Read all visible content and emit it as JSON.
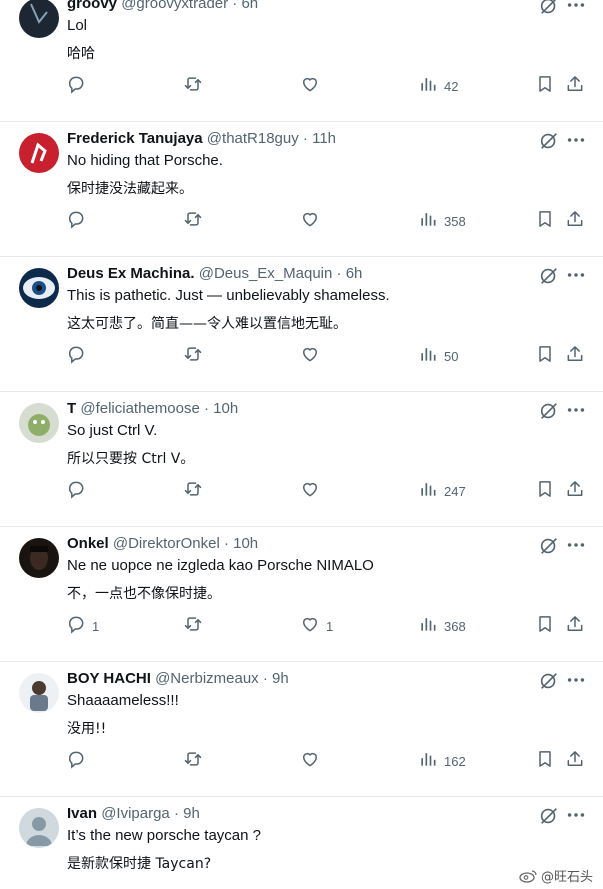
{
  "tweets": [
    {
      "name": "groovy",
      "handle": "@groovyxtrader",
      "time": "6h",
      "text_en": "Lol",
      "text_zh": "哈哈",
      "replies": "",
      "likes": "",
      "views": "42",
      "avatar_color": "#1c2733"
    },
    {
      "name": "Frederick Tanujaya",
      "handle": "@thatR18guy",
      "time": "11h",
      "text_en": "No hiding that Porsche.",
      "text_zh": "保时捷没法藏起来。",
      "replies": "",
      "likes": "",
      "views": "358",
      "avatar_color": "#c8202f"
    },
    {
      "name": "Deus Ex Machina.",
      "handle": "@Deus_Ex_Maquin",
      "time": "6h",
      "text_en": "This is pathetic. Just — unbelievably shameless.",
      "text_zh": "这太可悲了。简直——令人难以置信地无耻。",
      "replies": "",
      "likes": "",
      "views": "50",
      "avatar_color": "#1b4f8a"
    },
    {
      "name": "T",
      "handle": "@feliciathemoose",
      "time": "10h",
      "text_en": "So just Ctrl V.",
      "text_zh": "所以只要按 Ctrl V。",
      "replies": "",
      "likes": "",
      "views": "247",
      "avatar_color": "#8fae6a"
    },
    {
      "name": "Onkel",
      "handle": "@DirektorOnkel",
      "time": "10h",
      "text_en": "Ne ne uopce ne izgleda kao Porsche NIMALO",
      "text_zh": "不，一点也不像保时捷。",
      "replies": "1",
      "likes": "1",
      "views": "368",
      "avatar_color": "#3a2a22"
    },
    {
      "name": "BOY HACHI",
      "handle": "@Nerbizmeaux",
      "time": "9h",
      "text_en": "Shaaaameless!!!",
      "text_zh": "没用!!",
      "replies": "",
      "likes": "",
      "views": "162",
      "avatar_color": "#6a7a8c"
    },
    {
      "name": "Ivan",
      "handle": "@Iviparga",
      "time": "9h",
      "text_en": "It’s the new porsche taycan ?",
      "text_zh": "是新款保时捷 Taycan?",
      "replies": "",
      "likes": "",
      "views": "",
      "avatar_color": "#cfd9de"
    }
  ],
  "watermark": "@旺石头",
  "colors": {
    "text": "#0f1419",
    "muted": "#536471",
    "divider": "#e7e9ea"
  }
}
